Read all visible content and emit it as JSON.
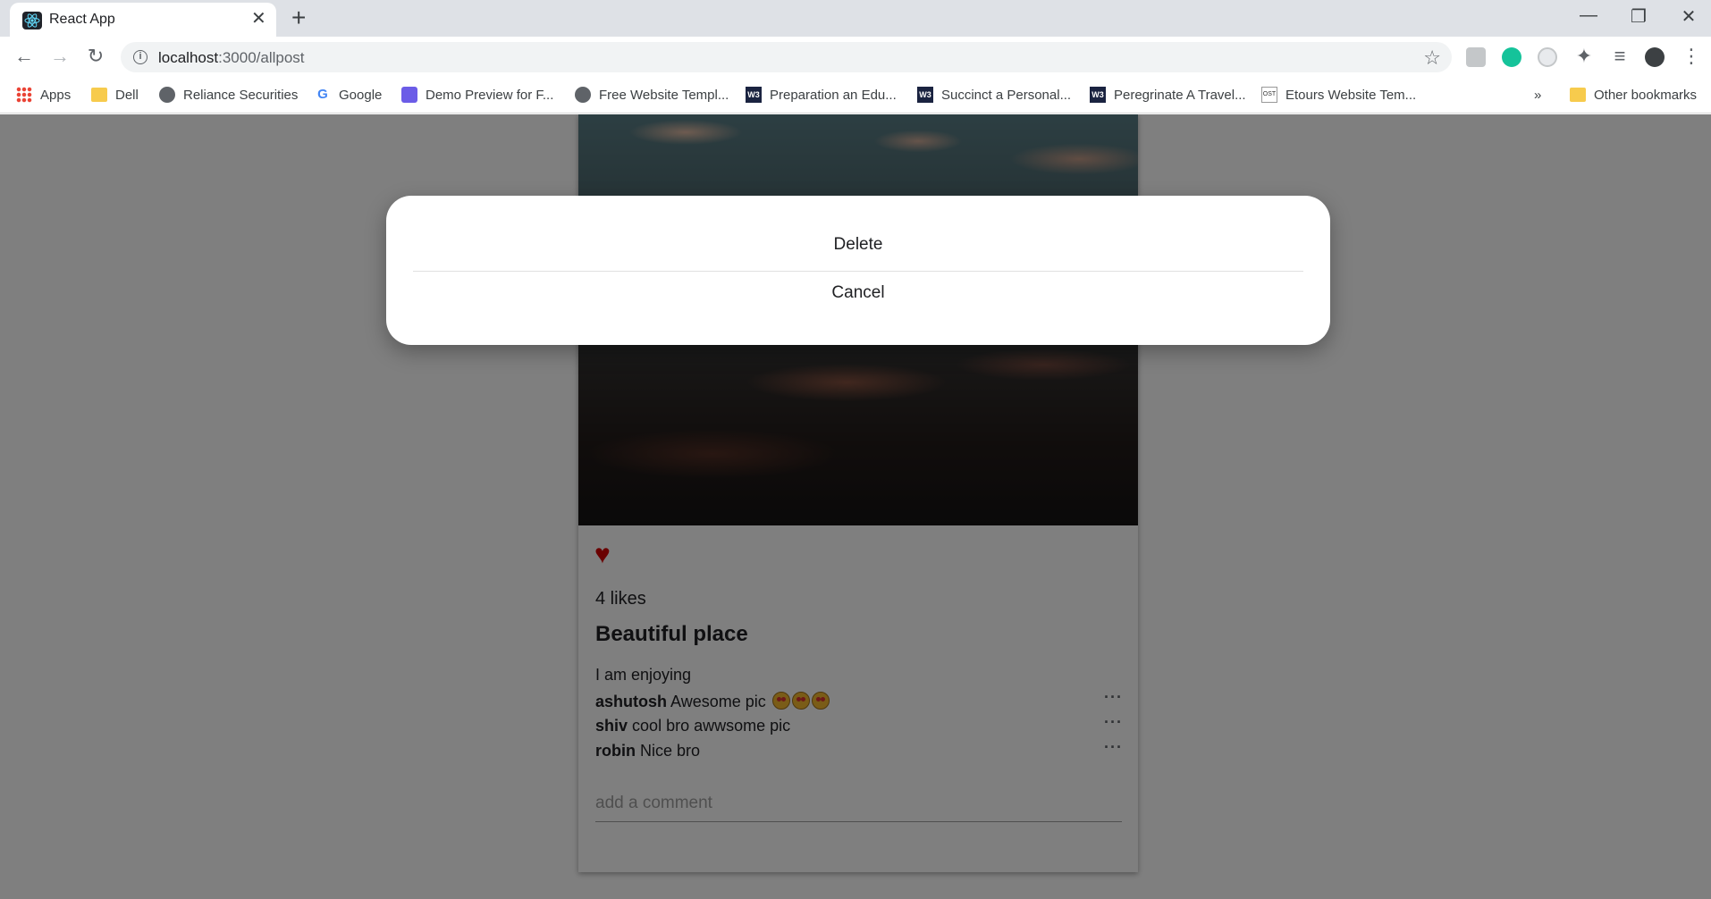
{
  "browser": {
    "tab_title": "React App",
    "tab_close": "✕",
    "new_tab": "+",
    "url_host": "localhost",
    "url_path": ":3000/allpost",
    "window_minimize": "—",
    "window_restore": "❐",
    "window_close": "✕"
  },
  "bookmarks": [
    {
      "label": "Apps",
      "icon": "apps-icon"
    },
    {
      "label": "Dell",
      "icon": "folder-icon"
    },
    {
      "label": "Reliance Securities",
      "icon": "globe-icon"
    },
    {
      "label": "Google",
      "icon": "google-icon"
    },
    {
      "label": "Demo Preview for F...",
      "icon": "demo-icon"
    },
    {
      "label": "Free Website Templ...",
      "icon": "globe-icon"
    },
    {
      "label": "Preparation an Edu...",
      "icon": "w3-icon"
    },
    {
      "label": "Succinct a Personal...",
      "icon": "w3-icon"
    },
    {
      "label": "Peregrinate A Travel...",
      "icon": "w3-icon"
    },
    {
      "label": "Etours Website Tem...",
      "icon": "ost-icon"
    }
  ],
  "bookmarks_overflow": "»",
  "other_bookmarks": "Other bookmarks",
  "post": {
    "likes": "4 likes",
    "title": "Beautiful place",
    "description": "I am enjoying",
    "comments": [
      {
        "user": "ashutosh",
        "text": "Awesome pic",
        "emojis": 3
      },
      {
        "user": "shiv",
        "text": "cool bro awwsome pic",
        "emojis": 0
      },
      {
        "user": "robin",
        "text": "Nice bro",
        "emojis": 0
      }
    ],
    "more": "···",
    "comment_placeholder": "add a comment"
  },
  "modal": {
    "delete_label": "Delete",
    "cancel_label": "Cancel"
  },
  "colors": {
    "heart": "#d50000",
    "overlay": "rgba(0,0,0,0.5)"
  }
}
